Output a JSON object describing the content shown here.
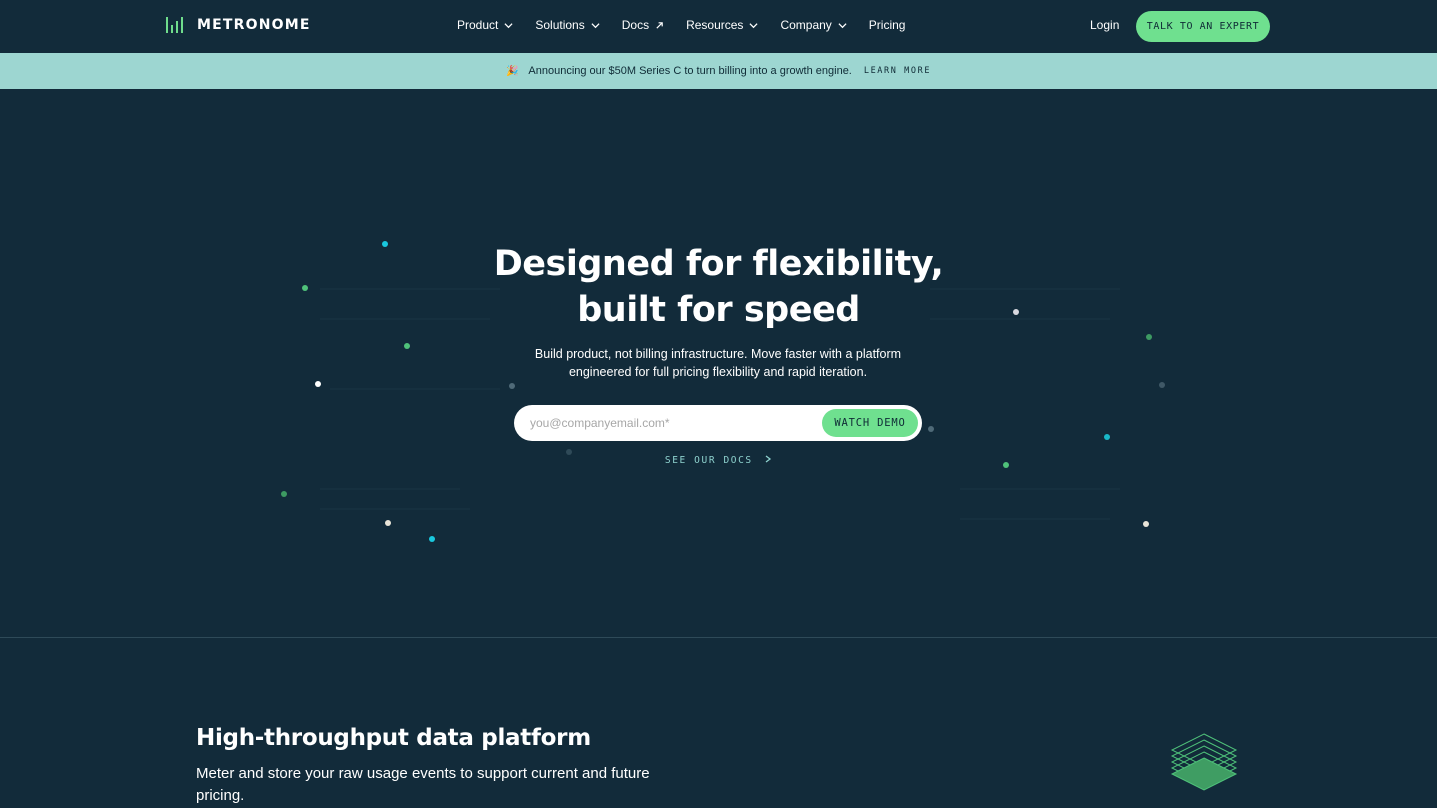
{
  "nav": {
    "brand": "METRONOME",
    "items": [
      {
        "label": "Product",
        "icon": "chevron-down-icon"
      },
      {
        "label": "Solutions",
        "icon": "chevron-down-icon"
      },
      {
        "label": "Docs",
        "icon": "external-arrow-icon"
      },
      {
        "label": "Resources",
        "icon": "chevron-down-icon"
      },
      {
        "label": "Company",
        "icon": "chevron-down-icon"
      },
      {
        "label": "Pricing",
        "icon": ""
      }
    ],
    "login": "Login",
    "cta": "TALK TO AN EXPERT"
  },
  "banner": {
    "icon": "party-popper-icon",
    "text": "Announcing our $50M Series C to turn billing into a growth engine.",
    "link": "LEARN MORE"
  },
  "hero": {
    "title_line1": "Designed for flexibility,",
    "title_line2": "built for speed",
    "subtitle": "Build product, not billing infrastructure. Move faster with a platform engineered for full pricing flexibility and rapid iteration.",
    "email_placeholder": "you@companyemail.com*",
    "watch_demo": "WATCH DEMO",
    "see_docs": "SEE OUR DOCS"
  },
  "feature": {
    "title": "High-throughput data platform",
    "description": "Meter and store your raw usage events to support current and future pricing.",
    "icon": "layers-stack-icon"
  },
  "colors": {
    "background": "#122b3a",
    "accent_green": "#6fe08f",
    "banner": "#9dd6d1",
    "link_teal": "#8fd3cf"
  }
}
